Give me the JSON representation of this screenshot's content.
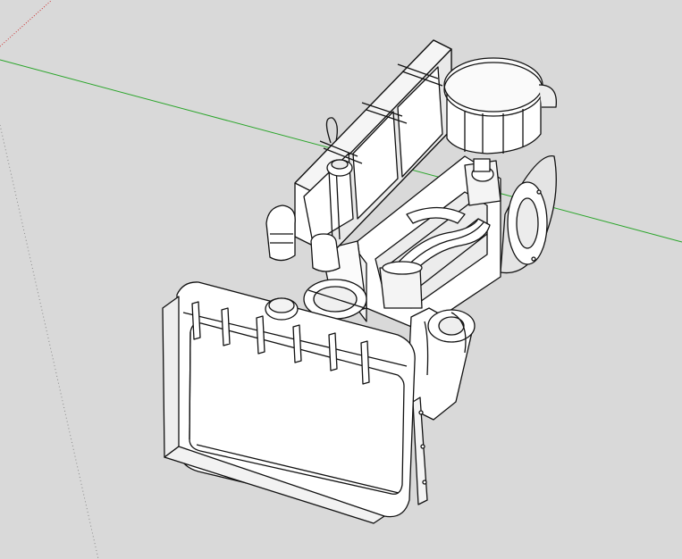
{
  "viewport": {
    "background": "#d9d9d9",
    "axis_colors": {
      "green": "#2aa52a",
      "red": "#cc3333",
      "guide": "#8a8a8a"
    },
    "model_colors": {
      "stroke": "#111111",
      "fill": "#ffffff",
      "shade": "#dcdcdc",
      "dark": "#b5b5b5"
    }
  },
  "model": {
    "parts": [
      "radiator",
      "radiator-cap",
      "engine-block",
      "rocker-cover",
      "oil-filler-cap",
      "oil-filter",
      "air-cleaner",
      "intake-pipe",
      "flywheel-housing",
      "starter-motor"
    ]
  }
}
